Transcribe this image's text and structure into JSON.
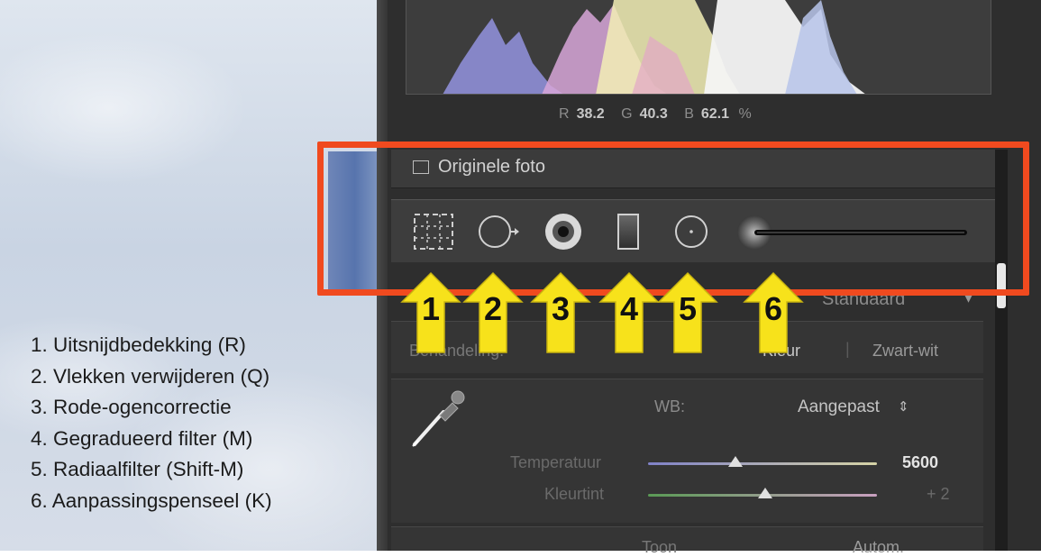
{
  "legend": {
    "items": [
      "1. Uitsnijdbedekking (R)",
      "2. Vlekken verwijderen (Q)",
      "3. Rode-ogencorrectie",
      "4. Gegradueerd filter (M)",
      "5. Radiaalfilter (Shift-M)",
      "6. Aanpassingspenseel (K)"
    ]
  },
  "histogram": {
    "readout": {
      "r_label": "R",
      "r_value": "38.2",
      "g_label": "G",
      "g_value": "40.3",
      "b_label": "B",
      "b_value": "62.1",
      "unit": "%"
    }
  },
  "original_photo": {
    "label": "Originele foto"
  },
  "tools": [
    {
      "number": "1",
      "icon": "crop-overlay-icon"
    },
    {
      "number": "2",
      "icon": "spot-removal-icon"
    },
    {
      "number": "3",
      "icon": "red-eye-icon"
    },
    {
      "number": "4",
      "icon": "graduated-filter-icon"
    },
    {
      "number": "5",
      "icon": "radial-filter-icon"
    },
    {
      "number": "6",
      "icon": "adjustment-brush-icon"
    }
  ],
  "profile": {
    "label": "Standaard"
  },
  "treatment": {
    "label": "Behandeling:",
    "color": "Kleur",
    "bw": "Zwart-wit"
  },
  "white_balance": {
    "label": "WB:",
    "value": "Aangepast",
    "temperature": {
      "label": "Temperatuur",
      "value": "5600",
      "fraction": 0.38
    },
    "tint": {
      "label": "Kleurtint",
      "value": "+ 2",
      "fraction": 0.51
    }
  },
  "tone": {
    "label": "Toon",
    "auto": "Autom."
  },
  "colors": {
    "highlight": "#f04a1f",
    "arrow": "#f7e21b"
  }
}
